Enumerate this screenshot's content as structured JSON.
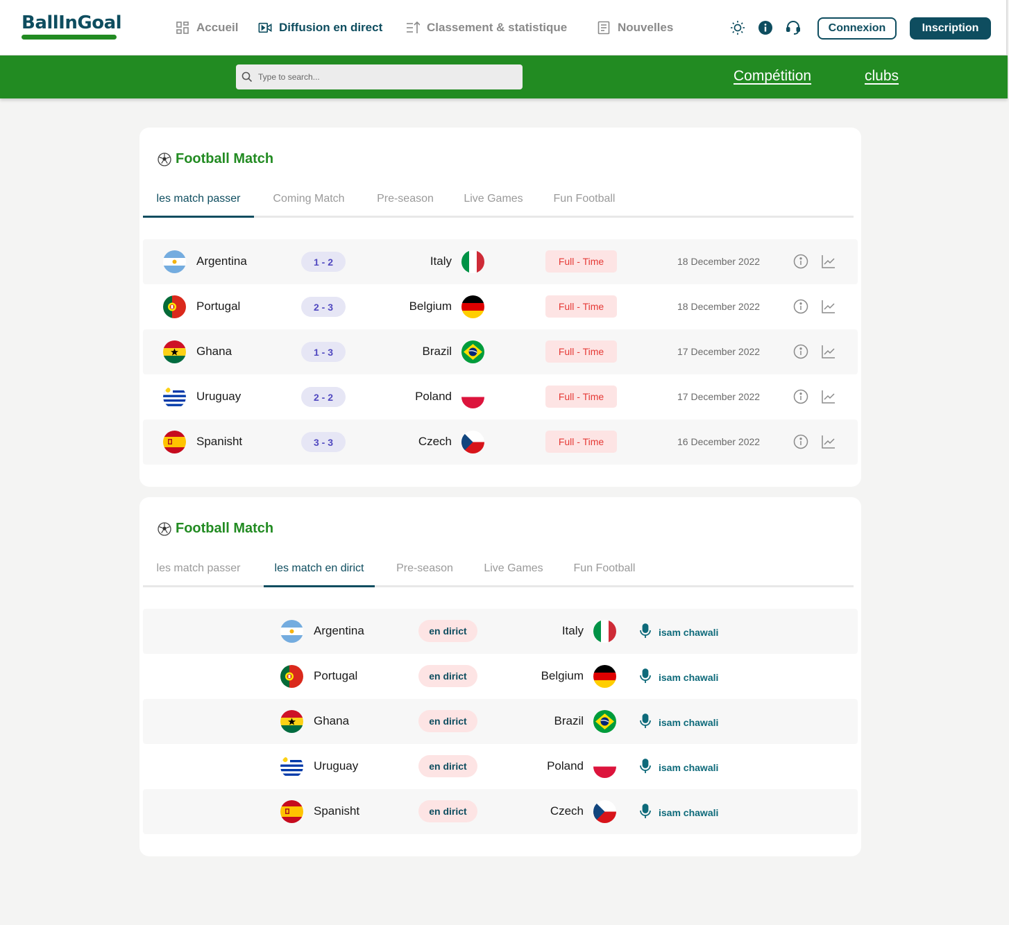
{
  "header": {
    "logo": "BallInGoal",
    "nav": [
      {
        "label": "Accueil",
        "icon": "grid-icon",
        "active": false
      },
      {
        "label": "Diffusion en direct",
        "icon": "video-icon",
        "active": true
      },
      {
        "label": "Classement & statistique",
        "icon": "ranking-icon",
        "active": false
      },
      {
        "label": "Nouvelles",
        "icon": "newspaper-icon",
        "active": false
      }
    ],
    "icons": [
      "sun-icon",
      "info-icon",
      "headset-icon"
    ],
    "login_label": "Connexion",
    "signup_label": "Inscription"
  },
  "subnav": {
    "search_placeholder": "Type to search...",
    "links": [
      "Compétition",
      "clubs"
    ]
  },
  "colors": {
    "brand": "#0e4d5f",
    "green": "#228b22",
    "danger": "#e53935",
    "score": "#5048c0"
  },
  "past_matches": {
    "title": "Football Match",
    "tabs": [
      "les match passer",
      "Coming Match",
      "Pre-season",
      "Live Games",
      "Fun Football"
    ],
    "active_tab": 0,
    "rows": [
      {
        "home": "Argentina",
        "home_flag": "argentina",
        "score": "1 - 2",
        "away": "Italy",
        "away_flag": "italy",
        "status": "Full - Time",
        "date": "18 December 2022"
      },
      {
        "home": "Portugal",
        "home_flag": "portugal",
        "score": "2 - 3",
        "away": "Belgium",
        "away_flag": "germany",
        "status": "Full - Time",
        "date": "18 December 2022"
      },
      {
        "home": "Ghana",
        "home_flag": "ghana",
        "score": "1 - 3",
        "away": "Brazil",
        "away_flag": "brazil",
        "status": "Full - Time",
        "date": "17 December 2022"
      },
      {
        "home": "Uruguay",
        "home_flag": "uruguay",
        "score": "2 - 2",
        "away": "Poland",
        "away_flag": "poland",
        "status": "Full - Time",
        "date": "17 December 2022"
      },
      {
        "home": "Spanisht",
        "home_flag": "spain",
        "score": "3 - 3",
        "away": "Czech",
        "away_flag": "czech",
        "status": "Full - Time",
        "date": "16 December 2022"
      }
    ]
  },
  "live_matches": {
    "title": "Football Match",
    "tabs": [
      "les match passer",
      "les match en dirict",
      "Pre-season",
      "Live Games",
      "Fun Football"
    ],
    "active_tab": 1,
    "rows": [
      {
        "home": "Argentina",
        "home_flag": "argentina",
        "badge": "en dirict",
        "away": "Italy",
        "away_flag": "italy",
        "commentator": "isam chawali"
      },
      {
        "home": "Portugal",
        "home_flag": "portugal",
        "badge": "en dirict",
        "away": "Belgium",
        "away_flag": "germany",
        "commentator": "isam chawali"
      },
      {
        "home": "Ghana",
        "home_flag": "ghana",
        "badge": "en dirict",
        "away": "Brazil",
        "away_flag": "brazil",
        "commentator": "isam chawali"
      },
      {
        "home": "Uruguay",
        "home_flag": "uruguay",
        "badge": "en dirict",
        "away": "Poland",
        "away_flag": "poland",
        "commentator": "isam chawali"
      },
      {
        "home": "Spanisht",
        "home_flag": "spain",
        "badge": "en dirict",
        "away": "Czech",
        "away_flag": "czech",
        "commentator": "isam chawali"
      }
    ]
  }
}
